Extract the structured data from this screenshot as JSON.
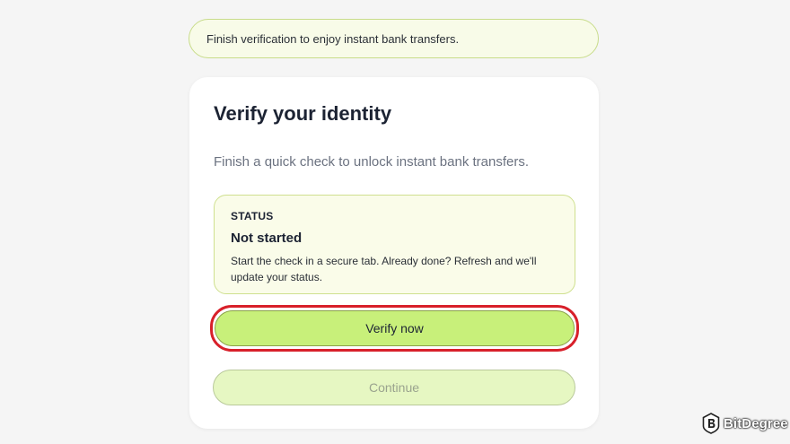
{
  "banner": {
    "text": "Finish verification to enjoy instant bank transfers."
  },
  "card": {
    "title": "Verify your identity",
    "subtitle": "Finish a quick check to unlock instant bank transfers.",
    "status": {
      "label": "STATUS",
      "value": "Not started",
      "description": "Start the check in a secure tab. Already done? Refresh and we'll update your status."
    },
    "verify_button": "Verify now",
    "continue_button": "Continue"
  },
  "watermark": {
    "text": "BitDegree",
    "icon": "bitdegree-logo-icon"
  },
  "colors": {
    "accent": "#c8f07a",
    "highlight": "#d8202a",
    "banner_bg": "#f8fbe8",
    "status_bg": "#fafce9"
  }
}
